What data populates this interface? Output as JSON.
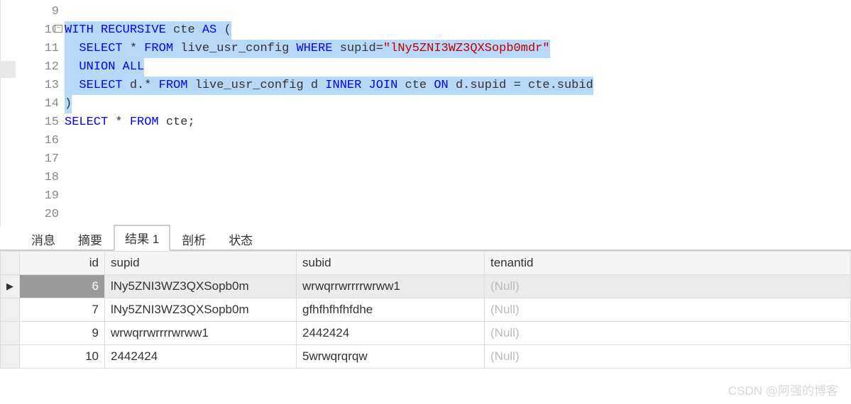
{
  "gutter": {
    "start": 9,
    "end": 20
  },
  "code": {
    "lines": [
      {
        "n": 9,
        "hl": false,
        "tokens": []
      },
      {
        "n": 10,
        "hl": true,
        "tokens": [
          {
            "c": "kw",
            "t": "WITH"
          },
          {
            "c": "plain",
            "t": " "
          },
          {
            "c": "kw",
            "t": "RECURSIVE"
          },
          {
            "c": "plain",
            "t": " cte "
          },
          {
            "c": "kw",
            "t": "AS"
          },
          {
            "c": "plain",
            "t": " ("
          }
        ]
      },
      {
        "n": 11,
        "hl": true,
        "indent": "  ",
        "tokens": [
          {
            "c": "kw",
            "t": "SELECT"
          },
          {
            "c": "plain",
            "t": " * "
          },
          {
            "c": "kw",
            "t": "FROM"
          },
          {
            "c": "plain",
            "t": " live_usr_config "
          },
          {
            "c": "kw",
            "t": "WHERE"
          },
          {
            "c": "plain",
            "t": " supid="
          },
          {
            "c": "str",
            "t": "\"lNy5ZNI3WZ3QXSopb0mdr\""
          }
        ]
      },
      {
        "n": 12,
        "hl": true,
        "indent": "  ",
        "tokens": [
          {
            "c": "kw",
            "t": "UNION"
          },
          {
            "c": "plain",
            "t": " "
          },
          {
            "c": "kw",
            "t": "ALL"
          }
        ]
      },
      {
        "n": 13,
        "hl": true,
        "indent": "  ",
        "tokens": [
          {
            "c": "kw",
            "t": "SELECT"
          },
          {
            "c": "plain",
            "t": " d.* "
          },
          {
            "c": "kw",
            "t": "FROM"
          },
          {
            "c": "plain",
            "t": " live_usr_config d "
          },
          {
            "c": "kw",
            "t": "INNER"
          },
          {
            "c": "plain",
            "t": " "
          },
          {
            "c": "kw",
            "t": "JOIN"
          },
          {
            "c": "plain",
            "t": " cte "
          },
          {
            "c": "kw",
            "t": "ON"
          },
          {
            "c": "plain",
            "t": " d.supid = cte.subid"
          }
        ]
      },
      {
        "n": 14,
        "hl": true,
        "tokens": [
          {
            "c": "plain",
            "t": ")"
          }
        ]
      },
      {
        "n": 15,
        "hl": false,
        "tokens": [
          {
            "c": "kw",
            "t": "SELECT"
          },
          {
            "c": "plain",
            "t": " * "
          },
          {
            "c": "kw",
            "t": "FROM"
          },
          {
            "c": "plain",
            "t": " cte;"
          }
        ]
      },
      {
        "n": 16,
        "hl": false,
        "tokens": []
      },
      {
        "n": 17,
        "hl": false,
        "tokens": []
      },
      {
        "n": 18,
        "hl": false,
        "tokens": []
      },
      {
        "n": 19,
        "hl": false,
        "tokens": []
      },
      {
        "n": 20,
        "hl": false,
        "tokens": []
      }
    ]
  },
  "tabs": {
    "items": [
      "消息",
      "摘要",
      "结果 1",
      "剖析",
      "状态"
    ],
    "active_index": 2
  },
  "grid": {
    "headers": [
      "id",
      "supid",
      "subid",
      "tenantid"
    ],
    "rows": [
      {
        "selected": true,
        "id": "6",
        "supid": "lNy5ZNI3WZ3QXSopb0m",
        "subid": "wrwqrrwrrrrwrww1",
        "tenantid": null
      },
      {
        "selected": false,
        "id": "7",
        "supid": "lNy5ZNI3WZ3QXSopb0m",
        "subid": "gfhfhfhfhfdhe",
        "tenantid": null
      },
      {
        "selected": false,
        "id": "9",
        "supid": "wrwqrrwrrrrwrww1",
        "subid": "2442424",
        "tenantid": null
      },
      {
        "selected": false,
        "id": "10",
        "supid": "2442424",
        "subid": "5wrwqrqrqw",
        "tenantid": null
      }
    ],
    "null_label": "(Null)"
  },
  "watermark": "CSDN @阿强的博客",
  "fold_glyph": "−"
}
